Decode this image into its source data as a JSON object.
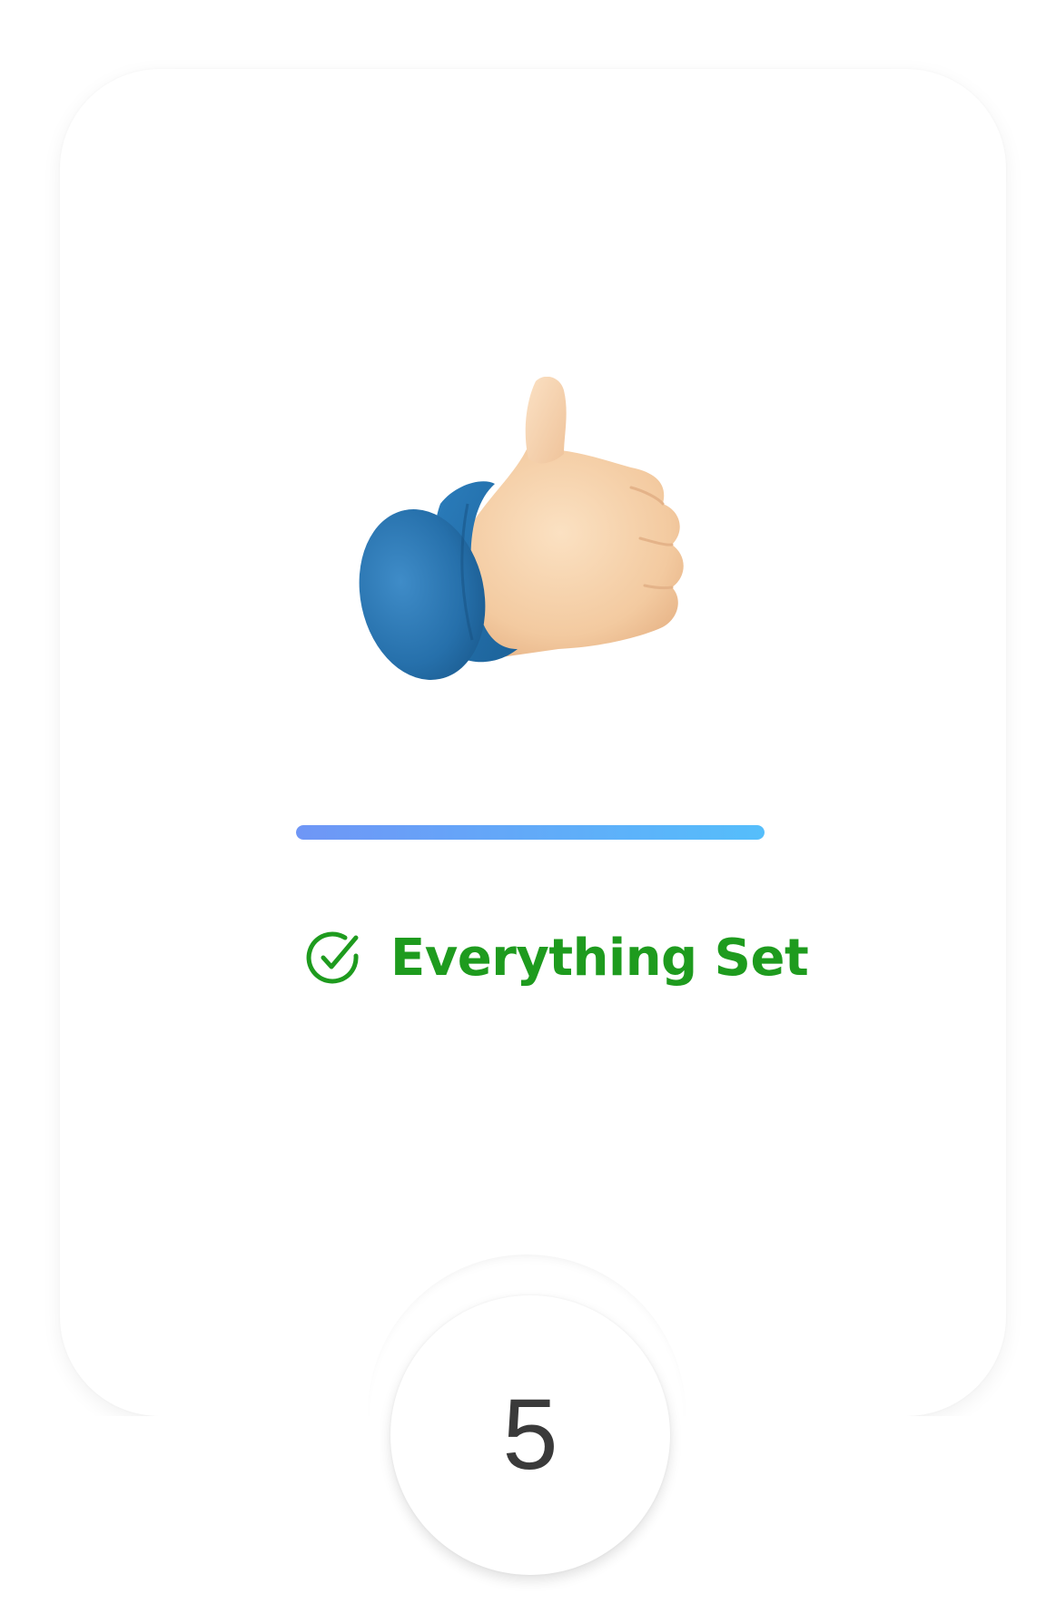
{
  "status": {
    "label": "Everything Set",
    "color": "#1e9b1e",
    "icon": "check-circle-icon"
  },
  "progress": {
    "percent": 100,
    "gradient_start": "#6f96f6",
    "gradient_end": "#55befb"
  },
  "illustration": {
    "icon": "thumbs-up-icon"
  },
  "step": {
    "number": "5"
  }
}
